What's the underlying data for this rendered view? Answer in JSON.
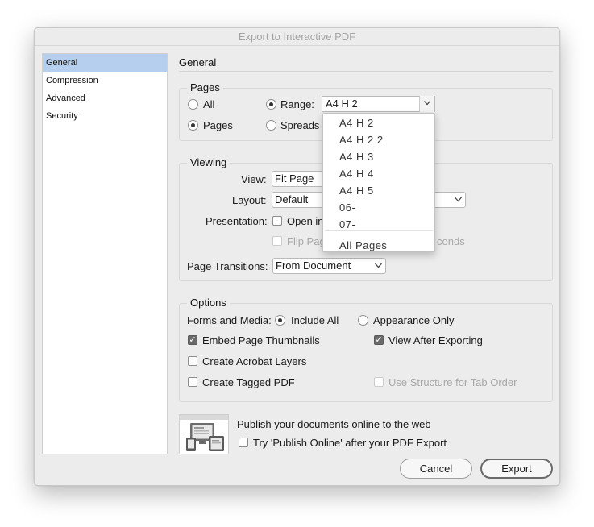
{
  "window": {
    "title": "Export to Interactive PDF"
  },
  "sidebar": {
    "items": [
      "General",
      "Compression",
      "Advanced",
      "Security"
    ],
    "selected": "General"
  },
  "main": {
    "heading": "General"
  },
  "pages": {
    "legend": "Pages",
    "all_label": "All",
    "range_label": "Range:",
    "range_value": "A4 H 2",
    "pages_label": "Pages",
    "spreads_label": "Spreads",
    "selected_radio": "Range",
    "selected_export": "Pages"
  },
  "range_dropdown": {
    "items": [
      "A4 H 2",
      "A4 H 2 2",
      "A4 H 3",
      "A4 H 4",
      "A4 H 5",
      "06-",
      "07-"
    ],
    "footer": "All Pages"
  },
  "viewing": {
    "legend": "Viewing",
    "view_label": "View:",
    "view_value": "Fit Page",
    "layout_label": "Layout:",
    "layout_value": "Default",
    "presentation_label": "Presentation:",
    "presentation_check": "Open in",
    "flip_label": "Flip Pag",
    "seconds_label": "conds",
    "transitions_label": "Page Transitions:",
    "transitions_value": "From Document"
  },
  "options": {
    "legend": "Options",
    "forms_label": "Forms and Media:",
    "include_all": "Include All",
    "appearance_only": "Appearance Only",
    "embed_thumbs": "Embed Page Thumbnails",
    "view_after": "View After Exporting",
    "acrobat_layers": "Create Acrobat Layers",
    "tagged_pdf": "Create Tagged PDF",
    "structure_tab": "Use Structure for Tab Order",
    "checked": {
      "embed_thumbs": true,
      "view_after": true,
      "acrobat_layers": false,
      "tagged_pdf": false,
      "structure_tab": false
    }
  },
  "publish": {
    "title": "Publish your documents online to the web",
    "try_label": "Try 'Publish Online' after your PDF Export",
    "icon": "devices-icon"
  },
  "buttons": {
    "cancel": "Cancel",
    "export": "Export"
  }
}
